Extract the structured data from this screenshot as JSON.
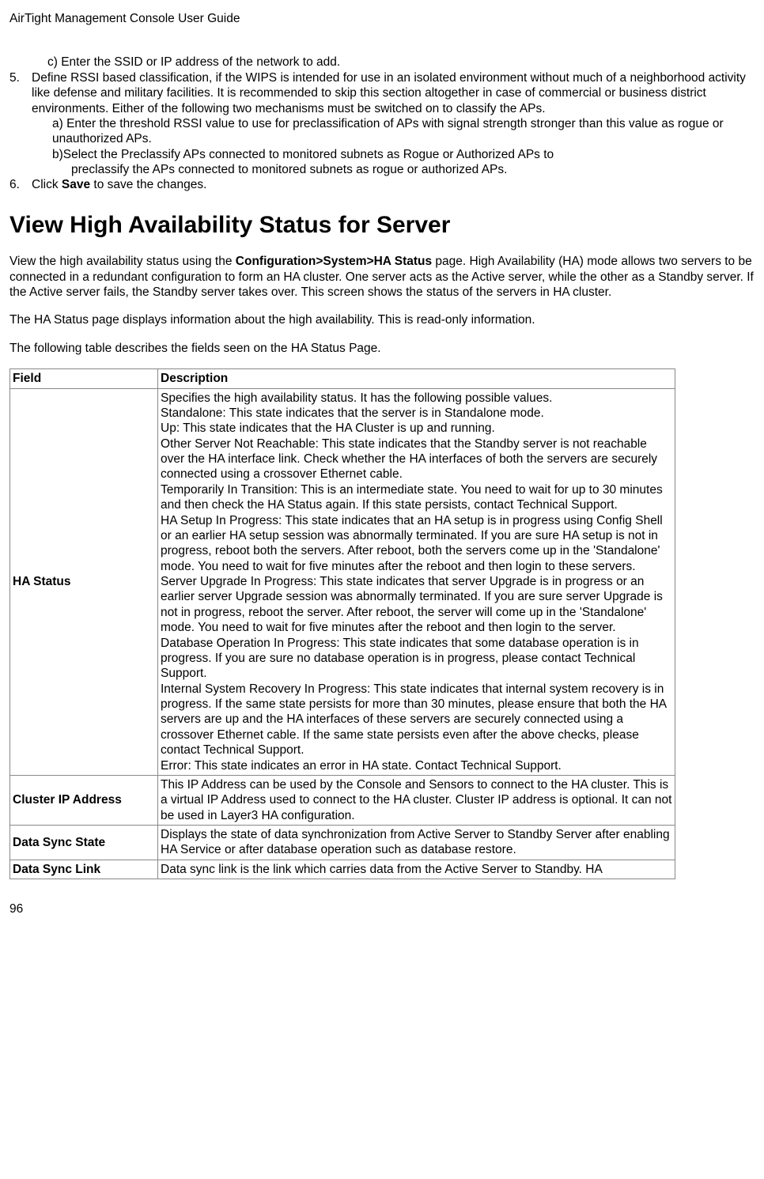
{
  "header": "AirTight Management Console User Guide",
  "step_c": "c) Enter the SSID or IP address of the network to add.",
  "step5_num": "5.",
  "step5_text": "Define RSSI based classification, if the WIPS is intended for use in an isolated environment without much of a neighborhood activity like defense and military facilities. It is recommended to skip this section altogether in case of commercial or business district environments. Either of the following two mechanisms must be switched on to classify the APs.",
  "step5_a": "a) Enter the threshold RSSI value to use for preclassification of APs with signal strength stronger than this value as rogue or unauthorized APs.",
  "step5_b": "b)Select the Preclassify APs connected to monitored subnets as Rogue or Authorized APs to preclassify the APs connected to monitored subnets as rogue or authorized APs.",
  "step6_num": "6.",
  "step6_prefix": "Click ",
  "step6_bold": "Save",
  "step6_suffix": " to save the changes.",
  "section_title": "View High Availability Status for Server",
  "intro_prefix": "View the high availability status using the ",
  "intro_bold": "Configuration>System>HA Status",
  "intro_suffix": " page. High Availability (HA) mode allows two servers to be connected in a redundant configuration to form an HA cluster. One server acts as the Active server, while the other as a Standby server. If the Active server fails, the Standby server takes over. This screen shows the status of the servers in HA cluster.",
  "para2": "The HA Status page displays information about the high availability. This is read-only information.",
  "para3": "The following table describes the fields seen on the HA Status Page.",
  "table": {
    "head_field": "Field",
    "head_desc": "Description",
    "rows": [
      {
        "field": "HA Status",
        "desc": "Specifies the high availability status. It has the following possible values.\nStandalone: This state indicates that the server is in Standalone mode.\nUp: This state indicates that the HA Cluster is up and running.\nOther Server Not Reachable: This state indicates that the Standby server is not reachable over the HA interface link. Check whether the HA interfaces of both the servers are securely connected using a crossover Ethernet cable.\nTemporarily In Transition: This is an intermediate state. You need to wait for up to 30 minutes and then check the HA Status again. If this state persists, contact Technical Support.\nHA Setup In Progress: This state indicates that an HA setup is in progress using Config Shell or an earlier HA setup session was abnormally terminated. If you are sure HA setup is not in progress, reboot both the servers. After reboot, both the servers come up in the 'Standalone' mode. You need to wait for five minutes after the reboot and then login to these servers.\nServer Upgrade In Progress: This state indicates that server Upgrade is in progress or an earlier server Upgrade session was abnormally terminated. If you are sure server Upgrade is not in progress, reboot the server. After reboot, the server will come up in the 'Standalone' mode. You need to wait for five minutes after the reboot and then login to the server.\nDatabase Operation In Progress: This state indicates that some database operation is in progress. If you are sure no database operation is in progress, please contact Technical Support.\nInternal System Recovery In Progress: This state indicates that internal system recovery is in progress. If the same state persists for more than 30 minutes, please ensure that both the HA servers are up and the HA interfaces of these servers are securely connected using a crossover Ethernet cable. If the same state persists even after the above checks, please contact Technical Support.\nError: This state indicates an error in HA state. Contact Technical Support."
      },
      {
        "field": " Cluster IP Address",
        "desc": "This IP Address can be used by the Console and Sensors to connect to the HA cluster. This is a virtual IP Address used to connect to the HA cluster. Cluster IP address is optional. It can not be used in Layer3 HA configuration."
      },
      {
        "field": "Data Sync State",
        "desc": "Displays the state of data synchronization from Active Server to Standby Server after enabling HA Service or after database operation such as database restore."
      },
      {
        "field": "Data Sync Link",
        "desc": "Data sync link is the link which carries data from the Active Server to Standby. HA"
      }
    ]
  },
  "page_number": "96"
}
